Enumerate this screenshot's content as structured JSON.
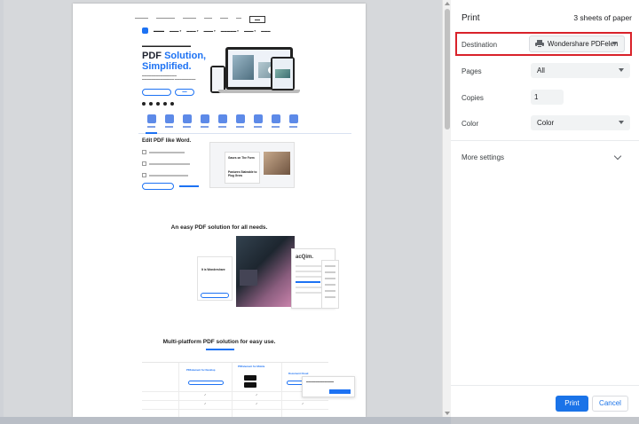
{
  "print": {
    "title": "Print",
    "sheets": "3 sheets of paper",
    "destination_label": "Destination",
    "destination_value": "Wondershare PDFelen",
    "pages_label": "Pages",
    "pages_value": "All",
    "copies_label": "Copies",
    "copies_value": "1",
    "color_label": "Color",
    "color_value": "Color",
    "more_settings_label": "More settings",
    "print_button": "Print",
    "cancel_button": "Cancel",
    "highlight_color": "#d9222a",
    "accent_color": "#1a73e8"
  },
  "preview": {
    "hero_title_1": "PDF",
    "hero_title_1_accent": "Solution,",
    "hero_title_2": "Simplified.",
    "edit_title": "Edit PDF like Word.",
    "edit_doc_heading": "Gases on The Form",
    "edit_doc_heading2": "Pastures Stainable to Plug Grow",
    "section2_title": "An easy PDF solution for all needs.",
    "card_heading": "It is Wondershare",
    "doc_card_title": "acQim.",
    "section3_title": "Multi-platform PDF solution for easy use.",
    "table_headers": [
      "PDFelement for Desktop",
      "PDFelement for Mobile",
      "Document Cloud"
    ]
  }
}
